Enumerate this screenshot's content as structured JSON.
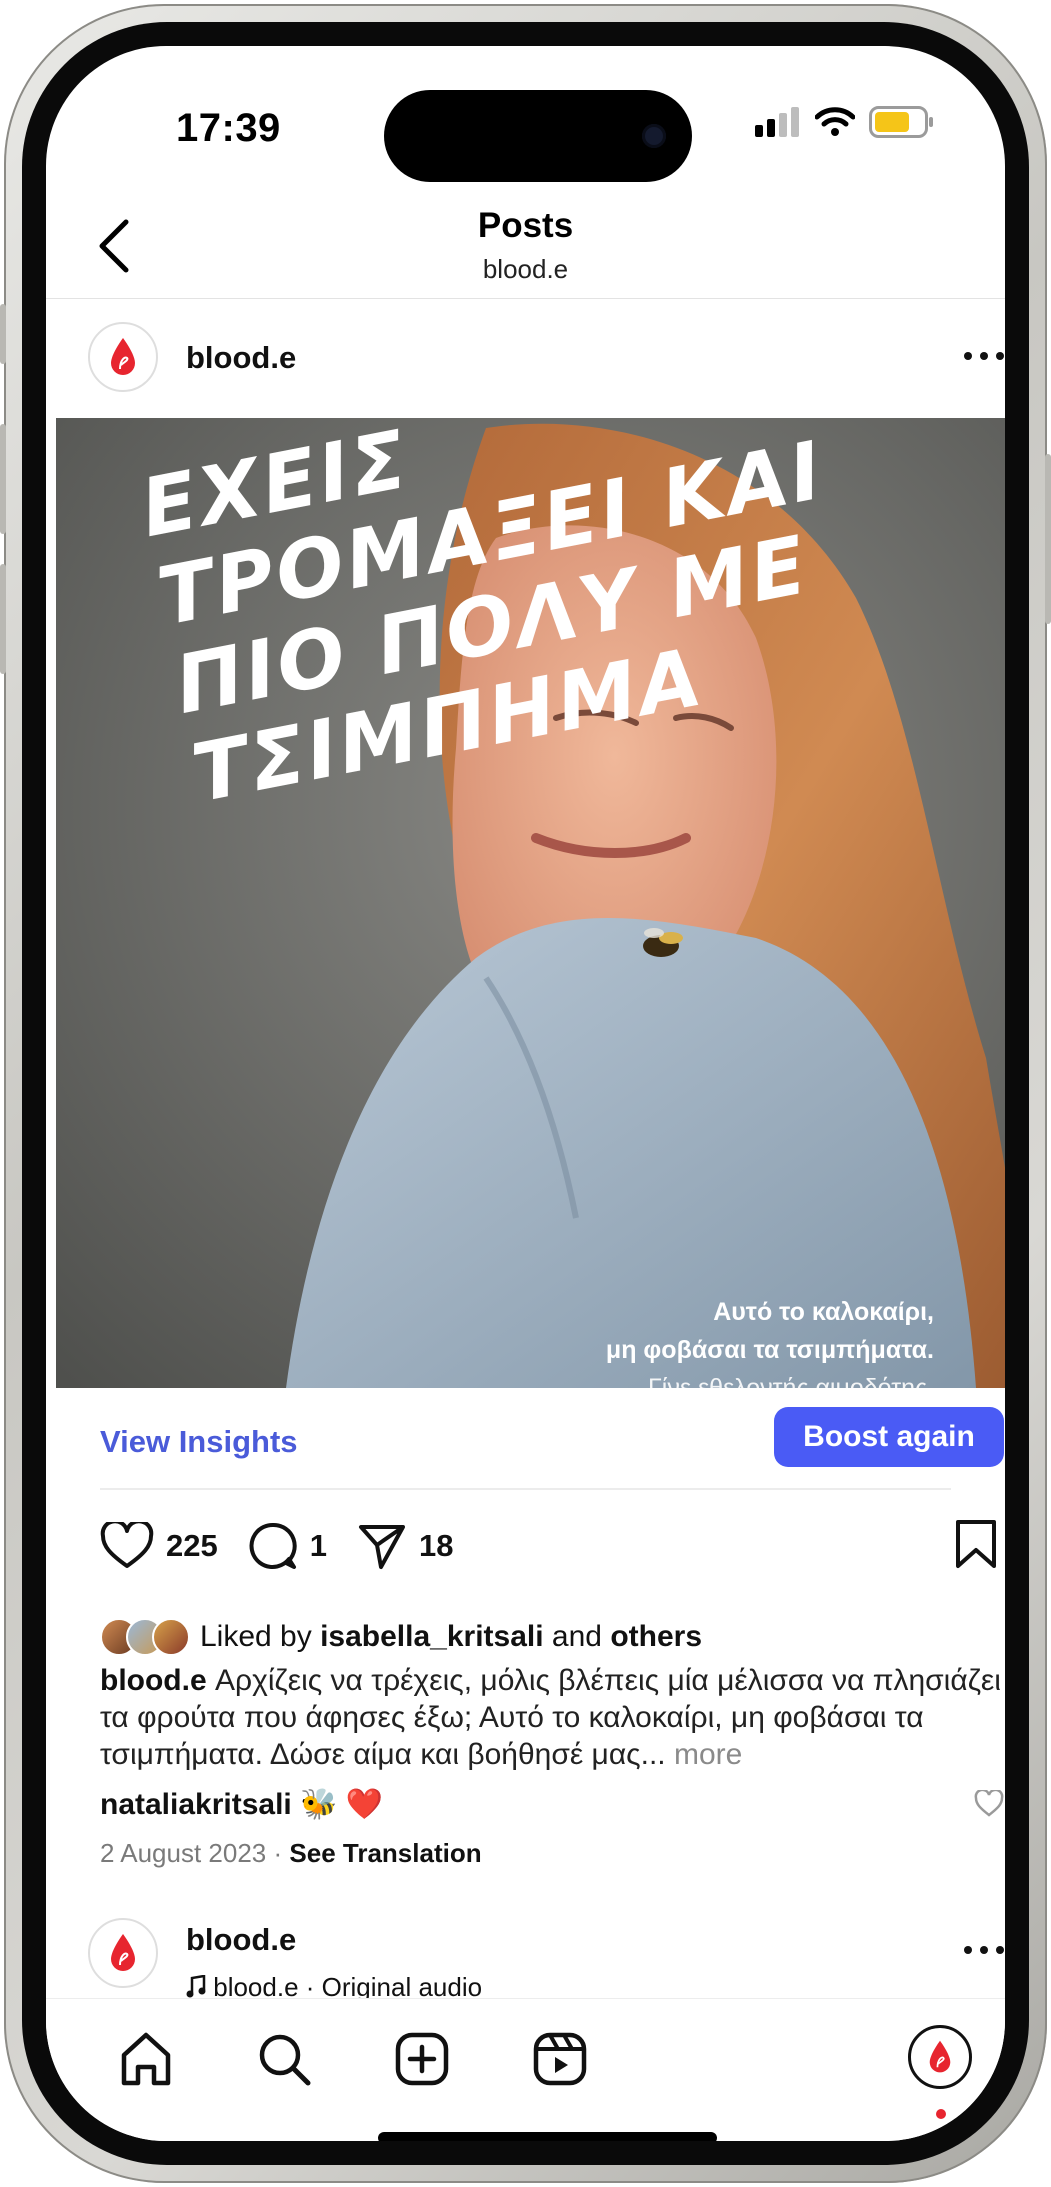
{
  "status": {
    "time": "17:39"
  },
  "header": {
    "title": "Posts",
    "subtitle": "blood.e"
  },
  "post": {
    "username": "blood.e",
    "image": {
      "headline_lines": [
        "ΕΧΕΙΣ",
        "ΤΡΟΜΑΞΕΙ ΚΑΙ",
        "ΠΙΟ ΠΟΛΥ ΜΕ",
        "ΤΣΙΜΠΗΜΑ"
      ],
      "caption_line1": "Αυτό το καλοκαίρι,",
      "caption_line2": "μη φοβάσαι τα τσιμπήματα.",
      "caption_line3": "Γίνε εθελοντής αιμοδότης."
    },
    "view_insights": "View Insights",
    "boost_label": "Boost again",
    "likes": "225",
    "comments": "1",
    "shares": "18",
    "liked_by_prefix": "Liked by",
    "liked_by_user": "isabella_kritsali",
    "liked_by_and": "and",
    "liked_by_others": "others",
    "caption_user": "blood.e",
    "caption_text": "Αρχίζεις να τρέχεις, μόλις βλέπεις μία μέλισσα να πλησιάζει τα φρούτα που άφησες έξω; Αυτό το καλοκαίρι, μη φοβάσαι τα τσιμπήματα. Δώσε αίμα και βοήθησέ μας...",
    "caption_more": "more",
    "comment_user": "nataliakritsali",
    "comment_text": "🐝 ❤️",
    "date": "2 August 2023",
    "meta_dot": "·",
    "see_translation": "See Translation"
  },
  "next_post": {
    "username": "blood.e",
    "subtitle": "blood.e · Original audio"
  },
  "colors": {
    "accent": "#4a5bf5",
    "link": "#4a5bd9",
    "brand_red": "#e7252f"
  },
  "tabs": [
    "home-icon",
    "search-icon",
    "create-icon",
    "reels-icon",
    "profile-icon"
  ]
}
